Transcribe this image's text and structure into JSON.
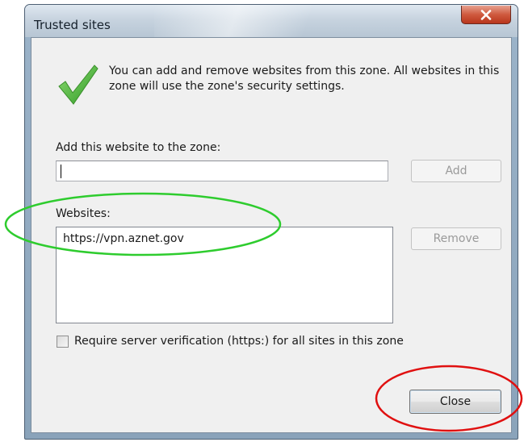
{
  "window": {
    "title": "Trusted sites"
  },
  "dialog": {
    "info_text": "You can add and remove websites from this zone. All websites in this zone will use the zone's security settings.",
    "add_label": "Add this website to the zone:",
    "add_input_value": "",
    "add_button": "Add",
    "websites_label": "Websites:",
    "websites": [
      "https://vpn.aznet.gov"
    ],
    "remove_button": "Remove",
    "require_verification_label": "Require server verification (https:) for all sites in this zone",
    "require_verification_checked": false,
    "close_button": "Close"
  },
  "colors": {
    "green_annotation": "#2ecc2e",
    "red_annotation": "#e01010",
    "checkmark": "#4fb83a"
  },
  "icons": {
    "checkmark": "checkmark-icon",
    "close": "close-icon"
  }
}
